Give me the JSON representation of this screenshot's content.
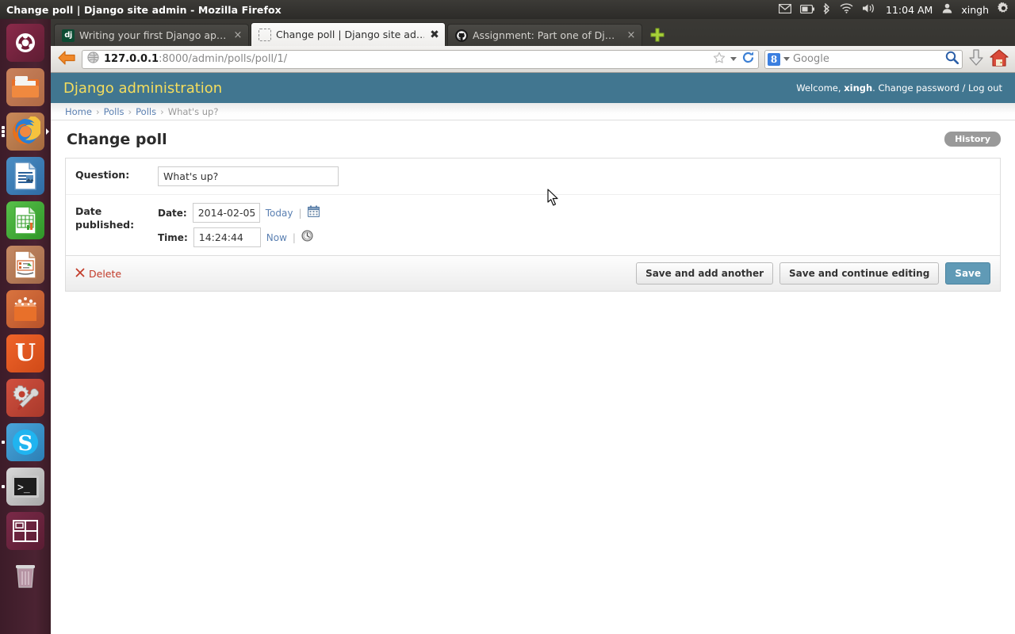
{
  "window": {
    "title": "Change poll | Django site admin - Mozilla Firefox"
  },
  "tray": {
    "icons": [
      "envelope-icon",
      "battery-icon",
      "bluetooth-icon",
      "wifi-icon",
      "volume-icon"
    ],
    "clock": "11:04 AM",
    "user": "xingh",
    "gear": "gear-icon"
  },
  "launcher": {
    "items": [
      {
        "name": "ubuntu-dash",
        "label": "Ubuntu Dash Home"
      },
      {
        "name": "files",
        "label": "Files"
      },
      {
        "name": "firefox",
        "label": "Firefox Web Browser"
      },
      {
        "name": "libreoffice-writer",
        "label": "LibreOffice Writer"
      },
      {
        "name": "libreoffice-calc",
        "label": "LibreOffice Calc"
      },
      {
        "name": "libreoffice-impress",
        "label": "LibreOffice Impress"
      },
      {
        "name": "software-center",
        "label": "Ubuntu Software Center"
      },
      {
        "name": "ubuntu-one",
        "label": "Ubuntu One"
      },
      {
        "name": "system-settings",
        "label": "System Settings"
      },
      {
        "name": "skype",
        "label": "Skype"
      },
      {
        "name": "terminal",
        "label": "Terminal"
      },
      {
        "name": "workspace-switcher",
        "label": "Workspace Switcher"
      },
      {
        "name": "trash",
        "label": "Trash"
      }
    ]
  },
  "browser": {
    "tabs": [
      {
        "title": "Writing your first Django ap…",
        "favicon": "django-icon",
        "active": false,
        "close": "×"
      },
      {
        "title": "Change poll | Django site ad…",
        "favicon": "blank-icon",
        "active": true,
        "close": "✖"
      },
      {
        "title": "Assignment: Part one of Dj…",
        "favicon": "github-icon",
        "active": false,
        "close": "×"
      }
    ],
    "new_tab_label": "+",
    "url_host": "127.0.0.1",
    "url_path": ":8000/admin/polls/poll/1/",
    "search_engine": "8",
    "search_placeholder": "Google",
    "back_icon": "back-arrow-icon",
    "reload_icon": "reload-icon",
    "bookmark_icon": "star-icon",
    "download_icon": "download-arrow-icon",
    "home_icon": "home-icon",
    "search_icon": "magnifier-icon"
  },
  "admin": {
    "branding": "Django administration",
    "welcome_prefix": "Welcome,",
    "username": "xingh",
    "welcome_suffix": ".",
    "change_password_label": "Change password",
    "separator": "/",
    "logout_label": "Log out",
    "breadcrumbs": [
      {
        "label": "Home",
        "link": true
      },
      {
        "label": "Polls",
        "link": true
      },
      {
        "label": "Polls",
        "link": true
      },
      {
        "label": "What's up?",
        "link": false
      }
    ],
    "breadcrumb_sep": "›",
    "page_title": "Change poll",
    "history_label": "History",
    "form": {
      "question_label": "Question:",
      "question_value": "What's up?",
      "date_published_label": "Date published:",
      "date_label": "Date:",
      "date_value": "2014-02-05",
      "today_label": "Today",
      "time_label": "Time:",
      "time_value": "14:24:44",
      "now_label": "Now",
      "pipe": "|",
      "calendar_icon": "calendar-icon",
      "clock_icon": "clock-icon"
    },
    "submit_row": {
      "delete_label": "Delete",
      "delete_icon": "delete-x-icon",
      "save_add_another": "Save and add another",
      "save_continue": "Save and continue editing",
      "save": "Save"
    },
    "colors": {
      "header_bg": "#417690",
      "branding": "#f5dd5d",
      "link": "#5b80b2",
      "delete": "#c23b29",
      "default_button": "#609ab6"
    }
  }
}
